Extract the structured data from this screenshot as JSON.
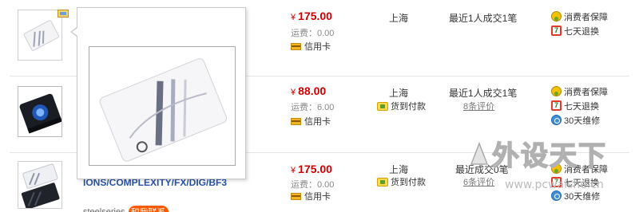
{
  "rows": [
    {
      "price_currency": "¥",
      "price": "175.00",
      "shipping": "运费：0.00",
      "card": "信用卡",
      "location": "上海",
      "deals": "最近1人成交1笔",
      "services": [
        "消费者保障",
        "七天退换"
      ]
    },
    {
      "price_currency": "¥",
      "price": "88.00",
      "shipping": "运费：6.00",
      "card": "信用卡",
      "location": "上海",
      "cod": "货到付款",
      "deals": "最近1人成交1笔",
      "reviews": "8条评价",
      "services": [
        "消费者保障",
        "七天退换",
        "30天维修"
      ]
    },
    {
      "price_currency": "¥",
      "price": "175.00",
      "shipping": "运费：0.00",
      "card": "信用卡",
      "location": "上海",
      "cod": "货到付款",
      "deals": "最近成交0笔",
      "reviews": "6条评价",
      "services": [
        "消费者保障",
        "七天退换",
        "30天维修"
      ],
      "title": "IONS/COMPLEXITY/FX/DIG/BF3",
      "brand": "steelseries",
      "brand_badge": "和我联系"
    }
  ],
  "watermark": {
    "text": "外设天下",
    "url": "www.pcwaishe.cn"
  },
  "colors": {
    "price": "#cc0000",
    "link": "#2953a6",
    "border": "#c9c9c9"
  }
}
